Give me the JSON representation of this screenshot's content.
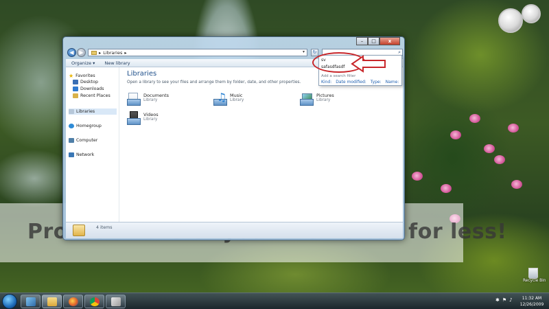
{
  "window": {
    "address": "Libraries",
    "caption": {
      "minimize": "–",
      "maximize": "□",
      "close": "x"
    },
    "toolbar": {
      "organize": "Organize ▾",
      "new_library": "New library"
    },
    "nav_pane": {
      "favorites": "Favorites",
      "desktop": "Desktop",
      "downloads": "Downloads",
      "recent_places": "Recent Places",
      "libraries": "Libraries",
      "homegroup": "Homegroup",
      "computer": "Computer",
      "network": "Network"
    },
    "main": {
      "title": "Libraries",
      "subtitle": "Open a library to see your files and arrange them by folder, date, and other properties.",
      "libraries": [
        {
          "name": "Documents",
          "type": "Library"
        },
        {
          "name": "Music",
          "type": "Library"
        },
        {
          "name": "Pictures",
          "type": "Library"
        },
        {
          "name": "Videos",
          "type": "Library"
        }
      ]
    },
    "status": {
      "count": "4 items"
    }
  },
  "search_dropdown": {
    "history": [
      "sv",
      "safasdfasdf"
    ],
    "filter_label": "Add a search filter",
    "filters": [
      "Kind:",
      "Date modified:",
      "Type:",
      "Name:"
    ]
  },
  "watermark": {
    "logo": "photobucket",
    "text": "Protect more of your memories for less!"
  },
  "desktop": {
    "recycle_bin": "Recycle Bin"
  },
  "taskbar": {
    "time": "11:32 AM",
    "date": "12/26/2009"
  },
  "colors": {
    "annotation_red": "#c8262a",
    "link_blue": "#1e5fb0",
    "title_blue": "#1e4f8a"
  }
}
